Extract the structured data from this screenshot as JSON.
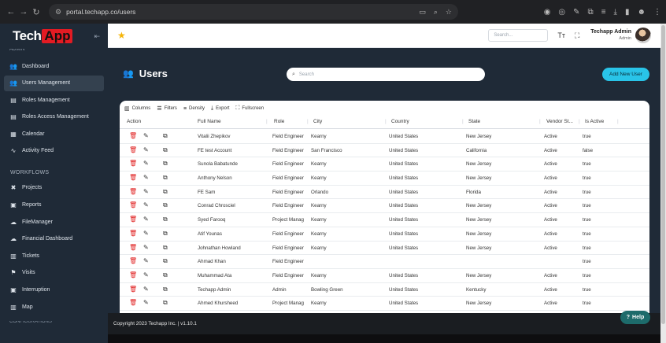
{
  "browser": {
    "url": "portal.techapp.co/users",
    "nav": [
      "←",
      "→",
      "↻"
    ]
  },
  "topbar": {
    "search_placeholder": "Search...",
    "user_name": "Techapp Admin",
    "user_role": "Admin"
  },
  "sidebar": {
    "logo_part1": "Tech",
    "logo_part2": "App",
    "hidden_section": "ADMIN",
    "items": [
      {
        "label": "Dashboard",
        "icon": "users-icon"
      },
      {
        "label": "Users Management",
        "icon": "users-icon",
        "active": true
      },
      {
        "label": "Roles Management",
        "icon": "table-icon"
      },
      {
        "label": "Roles Access Management",
        "icon": "table-icon"
      },
      {
        "label": "Calendar",
        "icon": "calendar-icon"
      },
      {
        "label": "Activity Feed",
        "icon": "activity-icon"
      }
    ],
    "workflows_heading": "WORKFLOWS",
    "workflow_items": [
      {
        "label": "Projects",
        "icon": "tools-icon"
      },
      {
        "label": "Reports",
        "icon": "report-icon"
      },
      {
        "label": "FileManager",
        "icon": "cloud-icon"
      },
      {
        "label": "Financial Dashboard",
        "icon": "cloud-icon"
      },
      {
        "label": "Tickets",
        "icon": "ticket-icon"
      },
      {
        "label": "Visits",
        "icon": "flag-icon"
      },
      {
        "label": "Interruption",
        "icon": "report-icon"
      },
      {
        "label": "Map",
        "icon": "map-icon"
      }
    ],
    "bottom_hidden": "CONFIGURATIONS"
  },
  "page": {
    "title": "Users",
    "search_placeholder": "Search",
    "add_button": "Add New User"
  },
  "table": {
    "toolbar": [
      "Columns",
      "Filters",
      "Density",
      "Export",
      "Fullscreen"
    ],
    "headers": {
      "action": "Action",
      "name": "Full Name",
      "role": "Role",
      "city": "City",
      "country": "Country",
      "state": "State",
      "vendor": "Vendor St...",
      "active": "Is Active"
    },
    "rows": [
      {
        "name": "Vitalii Zhepikov",
        "role": "Field Engineer",
        "city": "Kearny",
        "country": "United States",
        "state": "New Jersey",
        "vendor": "Active",
        "active": "true"
      },
      {
        "name": "FE test Account",
        "role": "Field Engineer",
        "city": "San Francisco",
        "country": "United States",
        "state": "California",
        "vendor": "Active",
        "active": "false"
      },
      {
        "name": "Sunola Babatunde",
        "role": "Field Engineer",
        "city": "Kearny",
        "country": "United States",
        "state": "New Jersey",
        "vendor": "Active",
        "active": "true"
      },
      {
        "name": "Anthony Nelson",
        "role": "Field Engineer",
        "city": "Kearny",
        "country": "United States",
        "state": "New Jersey",
        "vendor": "Active",
        "active": "true"
      },
      {
        "name": "FE Sam",
        "role": "Field Engineer",
        "city": "Orlando",
        "country": "United States",
        "state": "Florida",
        "vendor": "Active",
        "active": "true"
      },
      {
        "name": "Conrad Chrosciel",
        "role": "Field Engineer",
        "city": "Kearny",
        "country": "United States",
        "state": "New Jersey",
        "vendor": "Active",
        "active": "true"
      },
      {
        "name": "Syed Farooq",
        "role": "Project Manag",
        "city": "Kearny",
        "country": "United States",
        "state": "New Jersey",
        "vendor": "Active",
        "active": "true"
      },
      {
        "name": "Atif Younas",
        "role": "Field Engineer",
        "city": "Kearny",
        "country": "United States",
        "state": "New Jersey",
        "vendor": "Active",
        "active": "true"
      },
      {
        "name": "Johnathan Howland",
        "role": "Field Engineer",
        "city": "Kearny",
        "country": "United States",
        "state": "New Jersey",
        "vendor": "Active",
        "active": "true"
      },
      {
        "name": "Ahmad Khan",
        "role": "Field Engineer",
        "city": "",
        "country": "",
        "state": "",
        "vendor": "",
        "active": "true"
      },
      {
        "name": "Muhammad Ata",
        "role": "Field Engineer",
        "city": "Kearny",
        "country": "United States",
        "state": "New Jersey",
        "vendor": "Active",
        "active": "true"
      },
      {
        "name": "Techapp Admin",
        "role": "Admin",
        "city": "Bowling Green",
        "country": "United States",
        "state": "Kentucky",
        "vendor": "Active",
        "active": "true"
      },
      {
        "name": "Ahmed Khursheed",
        "role": "Project Manag",
        "city": "Kearny",
        "country": "United States",
        "state": "New Jersey",
        "vendor": "Active",
        "active": "true"
      }
    ]
  },
  "footer": {
    "text": "Copyright 2023 Techapp Inc. | v1.10.1"
  },
  "help": {
    "label": "Help"
  },
  "colors": {
    "sidebar": "#1f2a37",
    "accent": "#29c4e8",
    "brand_red": "#e21b23",
    "delete_red": "#e02020"
  }
}
